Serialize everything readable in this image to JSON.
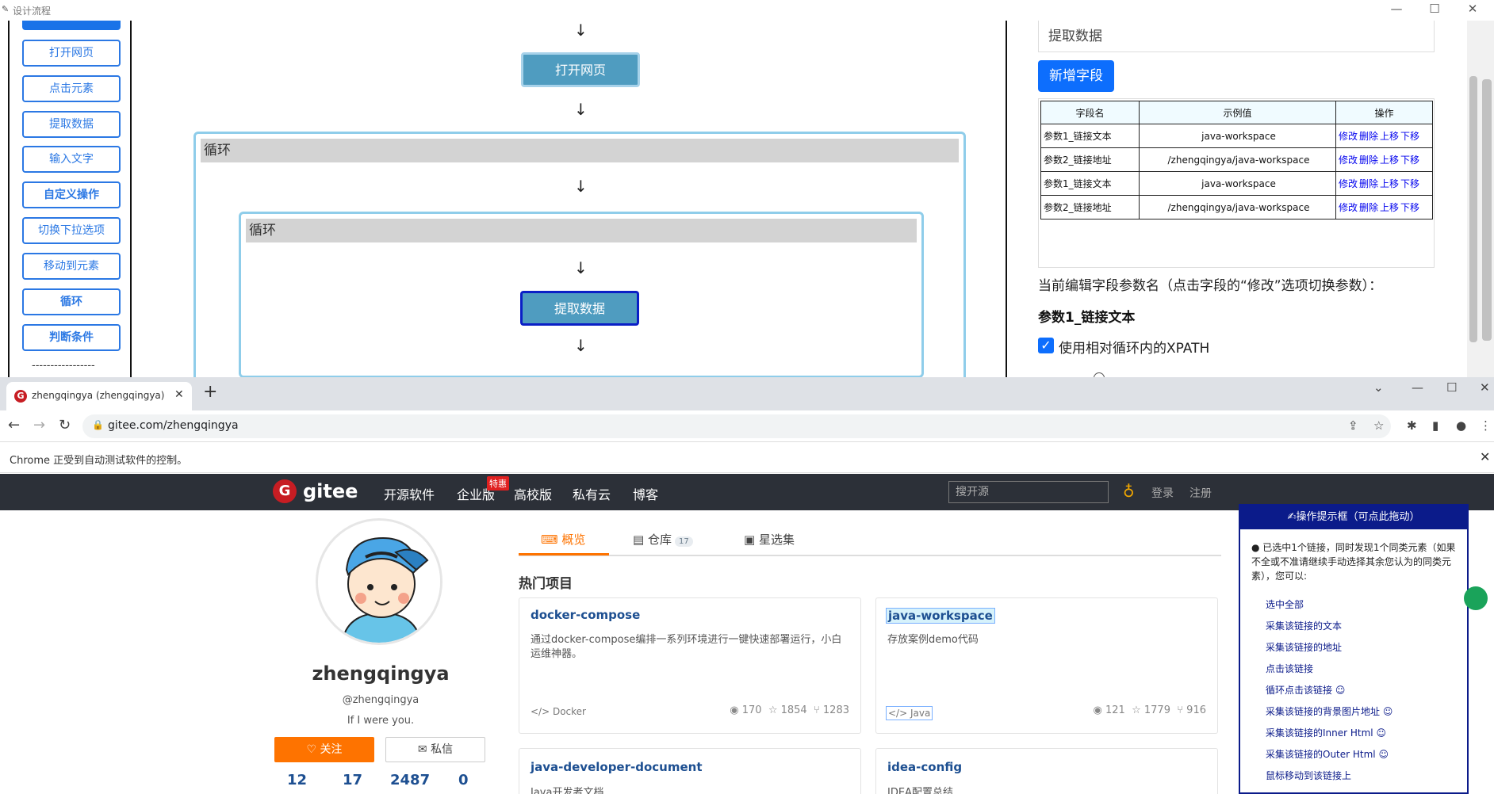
{
  "flow_window": {
    "title": "设计流程",
    "title_icon": "app-icon",
    "controls": [
      "—",
      "☐",
      "✕"
    ]
  },
  "toolbox": {
    "items": [
      "打开网页",
      "点击元素",
      "提取数据",
      "输入文字",
      "自定义操作",
      "切换下拉选项",
      "移动到元素",
      "循环",
      "判断条件"
    ],
    "divider": "-----------------"
  },
  "canvas": {
    "arrow": "↓",
    "node_open": "打开网页",
    "loop_outer": "循环",
    "loop_inner": "循环",
    "node_extract": "提取数据"
  },
  "props": {
    "field_input_value": "提取数据",
    "add_field_label": "新增字段",
    "table_headers": [
      "字段名",
      "示例值",
      "操作"
    ],
    "rows": [
      {
        "name": "参数1_链接文本",
        "value": "java-workspace"
      },
      {
        "name": "参数2_链接地址",
        "value": "/zhengqingya/java-workspace"
      },
      {
        "name": "参数1_链接文本",
        "value": "java-workspace"
      },
      {
        "name": "参数2_链接地址",
        "value": "/zhengqingya/java-workspace"
      }
    ],
    "ops": [
      "修改",
      "删除",
      "上移",
      "下移"
    ],
    "current_label": "当前编辑字段参数名（点击字段的“修改”选项切换参数）：",
    "current_field": "参数1_链接文本",
    "xpath_checkbox_label": "使用相对循环内的XPATH",
    "xpath_checked": true
  },
  "browser": {
    "tab_title": "zhengqingya (zhengqingya) - G",
    "url": "gitee.com/zhengqingya",
    "infobar": "Chrome 正受到自动测试软件的控制。",
    "window_controls": [
      "⌄",
      "—",
      "☐",
      "✕"
    ]
  },
  "gitee": {
    "logo_text": "gitee",
    "nav": [
      "开源软件",
      "企业版",
      "高校版",
      "私有云",
      "博客"
    ],
    "hot_badge": "特惠",
    "search_placeholder": "搜开源",
    "login": "登录",
    "register": "注册",
    "profile": {
      "name": "zhengqingya",
      "handle": "@zhengqingya",
      "bio": "If I were you.",
      "follow": "关注",
      "message": "私信",
      "stats": [
        "12",
        "17",
        "2487",
        "0"
      ]
    },
    "tabs": [
      {
        "label": "概览",
        "count": ""
      },
      {
        "label": "仓库",
        "count": "17"
      },
      {
        "label": "星选集",
        "count": ""
      }
    ],
    "hot_title": "热门项目",
    "projects": [
      {
        "name": "docker-compose",
        "desc": "通过docker-compose编排一系列环境进行一键快速部署运行，小白运维神器。",
        "lang": "Docker",
        "watch": "170",
        "star": "1854",
        "fork": "1283"
      },
      {
        "name": "java-workspace",
        "desc": "存放案例demo代码",
        "lang": "Java",
        "watch": "121",
        "star": "1779",
        "fork": "916"
      },
      {
        "name": "java-developer-document",
        "desc": "Java开发者文档"
      },
      {
        "name": "idea-config",
        "desc": "IDEA配置总结"
      }
    ]
  },
  "helper": {
    "title": "✍操作提示框（可点此拖动）",
    "desc": "● 已选中1个链接，同时发现1个同类元素（如果不全或不准请继续手动选择其余您认为的同类元素），您可以:",
    "options": [
      "选中全部",
      "采集该链接的文本",
      "采集该链接的地址",
      "点击该链接",
      "循环点击该链接 ☺",
      "采集该链接的背景图片地址 ☺",
      "采集该链接的Inner Html ☺",
      "采集该链接的Outer Html ☺",
      "鼠标移动到该链接上"
    ]
  },
  "colors": {
    "accent_blue": "#2b78e4",
    "node_fill": "#4f9cc0",
    "gitee_orange": "#fe7300",
    "gitee_nav_bg": "#2c3038",
    "helper_navy": "#0b1b8a"
  }
}
